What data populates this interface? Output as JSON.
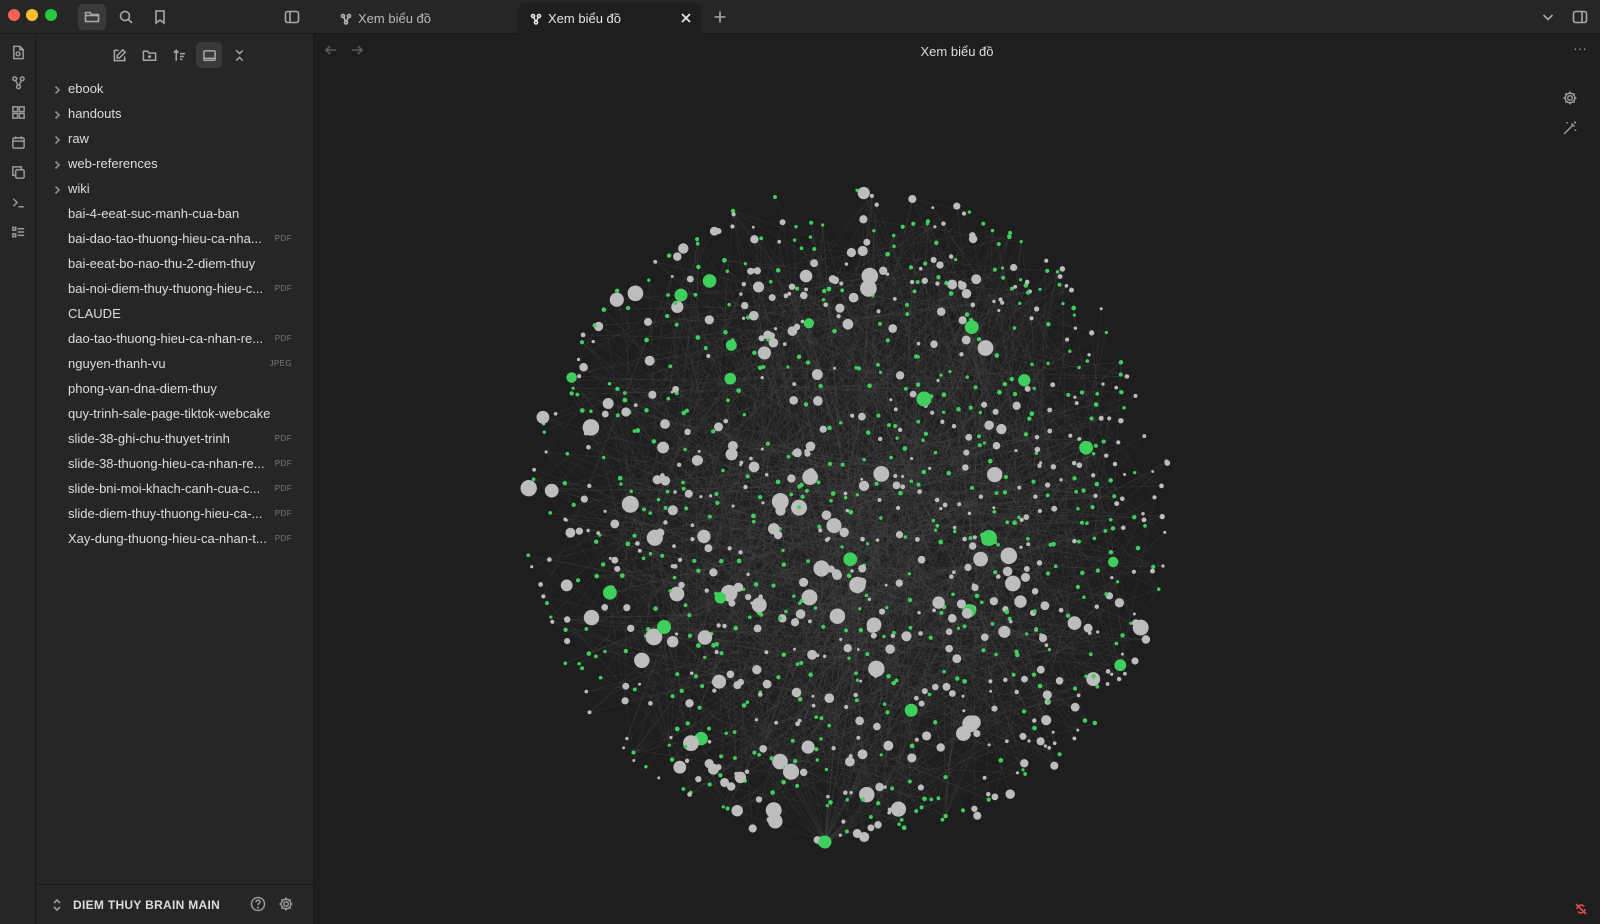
{
  "tabs": [
    {
      "label": "Xem biểu đồ",
      "active": false
    },
    {
      "label": "Xem biểu đồ",
      "active": true
    }
  ],
  "view": {
    "title": "Xem biểu đồ"
  },
  "file_tree": [
    {
      "label": "ebook",
      "type": "folder"
    },
    {
      "label": "handouts",
      "type": "folder"
    },
    {
      "label": "raw",
      "type": "folder"
    },
    {
      "label": "web-references",
      "type": "folder"
    },
    {
      "label": "wiki",
      "type": "folder"
    },
    {
      "label": "bai-4-eeat-suc-manh-cua-ban",
      "type": "file",
      "badge": ""
    },
    {
      "label": "bai-dao-tao-thuong-hieu-ca-nha...",
      "type": "file",
      "badge": "PDF"
    },
    {
      "label": "bai-eeat-bo-nao-thu-2-diem-thuy",
      "type": "file",
      "badge": ""
    },
    {
      "label": "bai-noi-diem-thuy-thuong-hieu-c...",
      "type": "file",
      "badge": "PDF"
    },
    {
      "label": "CLAUDE",
      "type": "file",
      "badge": ""
    },
    {
      "label": "dao-tao-thuong-hieu-ca-nhan-re...",
      "type": "file",
      "badge": "PDF"
    },
    {
      "label": "nguyen-thanh-vu",
      "type": "file",
      "badge": "JPEG"
    },
    {
      "label": "phong-van-dna-diem-thuy",
      "type": "file",
      "badge": ""
    },
    {
      "label": "quy-trinh-sale-page-tiktok-webcake",
      "type": "file",
      "badge": ""
    },
    {
      "label": "slide-38-ghi-chu-thuyet-trinh",
      "type": "file",
      "badge": "PDF"
    },
    {
      "label": "slide-38-thuong-hieu-ca-nhan-re...",
      "type": "file",
      "badge": "PDF"
    },
    {
      "label": "slide-bni-moi-khach-canh-cua-c...",
      "type": "file",
      "badge": "PDF"
    },
    {
      "label": "slide-diem-thuy-thuong-hieu-ca-...",
      "type": "file",
      "badge": "PDF"
    },
    {
      "label": "Xay-dung-thuong-hieu-ca-nhan-t...",
      "type": "file",
      "badge": "PDF"
    }
  ],
  "vault": {
    "name": "DIEM THUY BRAIN MAIN"
  },
  "graph": {
    "node_color_note": "#bdbdbd",
    "node_color_attachment": "#3ecf5c",
    "edge_color": "#4a4a4a",
    "background": "#1e1e1e"
  }
}
